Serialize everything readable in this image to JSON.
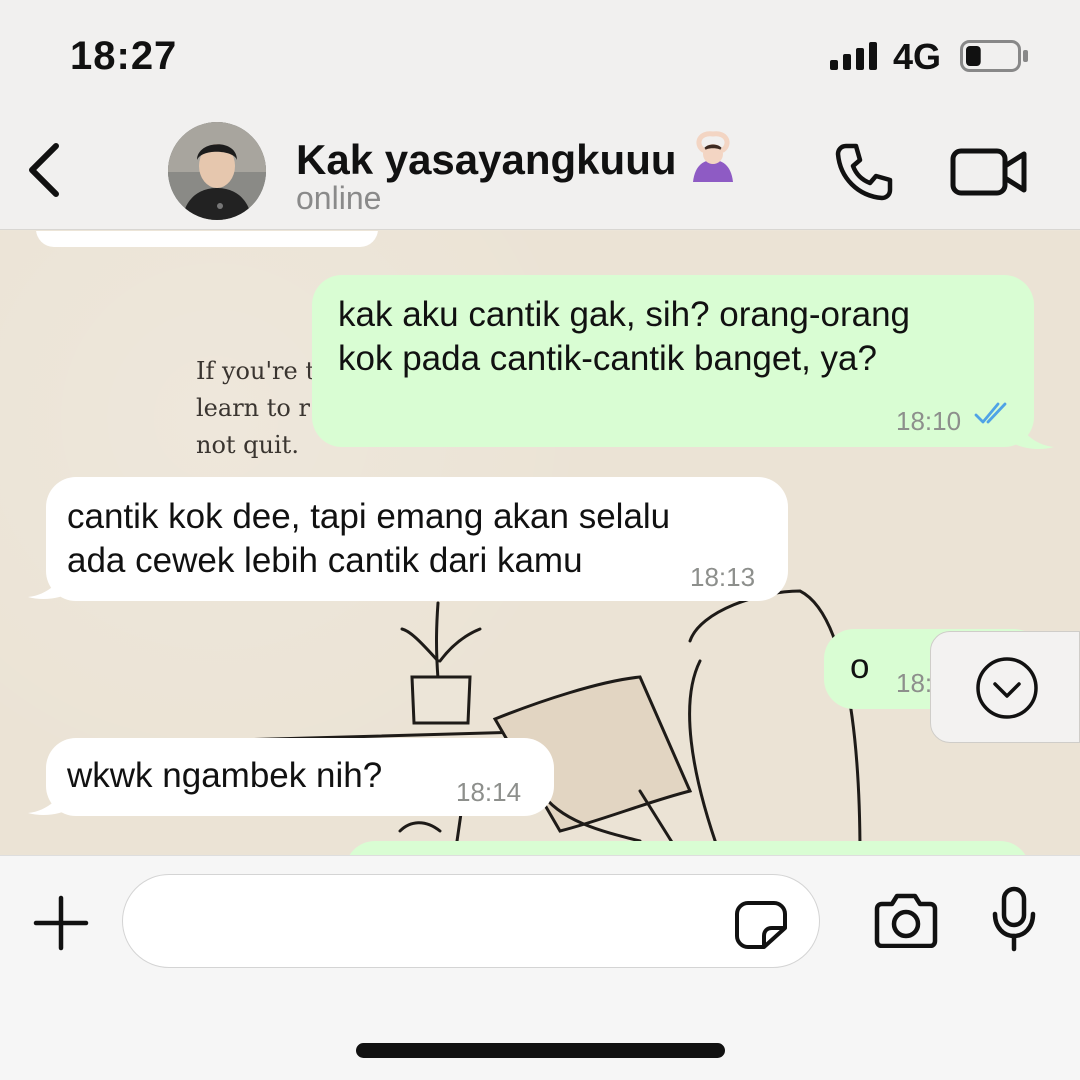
{
  "status_bar": {
    "time": "18:27",
    "network": "4G",
    "battery_level": 0.3
  },
  "header": {
    "contact_name": "Kak yasayangkuuu",
    "contact_emoji": "person-gesturing-ok-emoji",
    "contact_status": "online",
    "icons": {
      "back": "chevron-left-icon",
      "call": "phone-icon",
      "video": "video-camera-icon"
    }
  },
  "wallpaper": {
    "quote_lines": [
      "If you're t",
      "learn to r",
      "not quit."
    ]
  },
  "messages": [
    {
      "direction": "out",
      "lines": [
        "kak aku cantik gak, sih? orang-orang",
        "kok pada cantik-cantik banget, ya?"
      ],
      "time": "18:10",
      "read": true
    },
    {
      "direction": "in",
      "lines": [
        "cantik kok dee, tapi emang akan selalu",
        "ada cewek lebih cantik dari kamu"
      ],
      "time": "18:13"
    },
    {
      "direction": "out",
      "lines": [
        "o"
      ],
      "time": "18:"
    },
    {
      "direction": "in",
      "lines": [
        "wkwk ngambek nih?"
      ],
      "time": "18:14"
    }
  ],
  "input_bar": {
    "placeholder": "",
    "value": "",
    "icons": {
      "plus": "plus-icon",
      "sticker": "sticker-icon",
      "camera": "camera-icon",
      "mic": "microphone-icon"
    }
  },
  "colors": {
    "outgoing_bubble": "#d9fdd3",
    "incoming_bubble": "#ffffff",
    "read_ticks": "#4fa3e6",
    "bar_background": "#f1f0ef"
  }
}
